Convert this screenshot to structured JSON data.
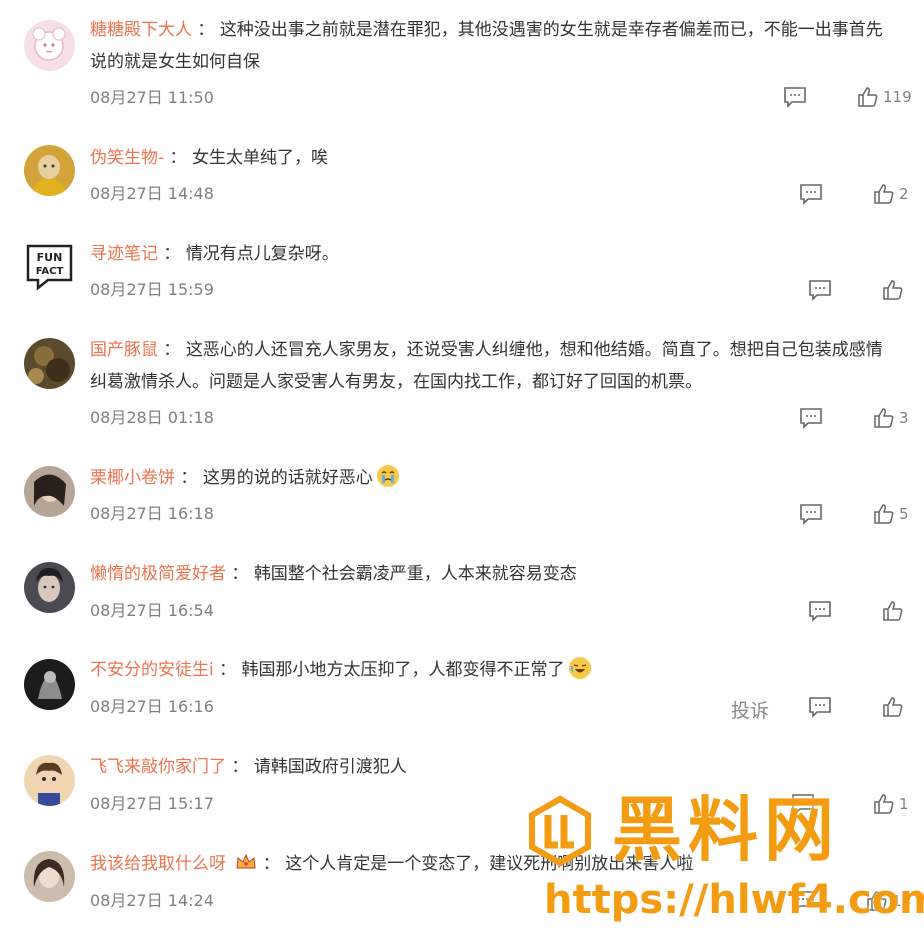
{
  "comments": [
    {
      "username": "糖糖殿下大人",
      "text_line1": "这种没出事之前就是潜在罪犯，其他没遇害的女生就是幸存者偏差而已，不能一出事首先",
      "text_line2": "说的就是女生如何自保",
      "time": "08月27日 11:50",
      "likes": "119",
      "avatar_color": "#f3d6e0"
    },
    {
      "username": "伪笑生物-",
      "text_line1": "女生太单纯了，唉",
      "text_line2": "",
      "time": "08月27日 14:48",
      "likes": "2",
      "avatar_color": "#c9a23b"
    },
    {
      "username": "寻迹笔记",
      "text_line1": "情况有点儿复杂呀。",
      "text_line2": "",
      "time": "08月27日 15:59",
      "likes": "",
      "avatar_color": "#ffffff"
    },
    {
      "username": "国产豚鼠",
      "text_line1": "这恶心的人还冒充人家男友，还说受害人纠缠他，想和他结婚。简直了。想把自己包装成感情",
      "text_line2": "纠葛激情杀人。问题是人家受害人有男友，在国内找工作，都订好了回国的机票。",
      "time": "08月28日 01:18",
      "likes": "3",
      "avatar_color": "#6b5a3a"
    },
    {
      "username": "栗椰小卷饼",
      "text_line1": "这男的说的话就好恶心",
      "text_line2": "",
      "time": "08月27日 16:18",
      "likes": "5",
      "avatar_color": "#8a7a6a"
    },
    {
      "username": "懒惰的极简爱好者",
      "text_line1": "韩国整个社会霸凌严重，人本来就容易变态",
      "text_line2": "",
      "time": "08月27日 16:54",
      "likes": "",
      "avatar_color": "#3a3a40"
    },
    {
      "username": "不安分的安徒生i",
      "text_line1": "韩国那小地方太压抑了，人都变得不正常了",
      "text_line2": "",
      "time": "08月27日 16:16",
      "likes": "",
      "avatar_color": "#2a2a2a"
    },
    {
      "username": "飞飞来敲你家门了",
      "text_line1": "请韩国政府引渡犯人",
      "text_line2": "",
      "time": "08月27日 15:17",
      "likes": "1",
      "avatar_color": "#d9a878"
    },
    {
      "username": "我该给我取什么呀",
      "text_line1": "这个人肯定是一个变态了，建议死刑啊别放出来害人啦",
      "text_line2": "",
      "time": "08月27日 14:24",
      "likes": "14",
      "avatar_color": "#c8b8a8"
    }
  ],
  "report_label": "投诉",
  "icons": {
    "reply": "comment-bubble-icon",
    "like": "thumbs-up-icon"
  },
  "watermark": {
    "title": "黑料网",
    "url": "https://hlwf4.com"
  },
  "colors": {
    "username": "#eb7350",
    "time": "#808080",
    "watermark": "#f39c12"
  }
}
